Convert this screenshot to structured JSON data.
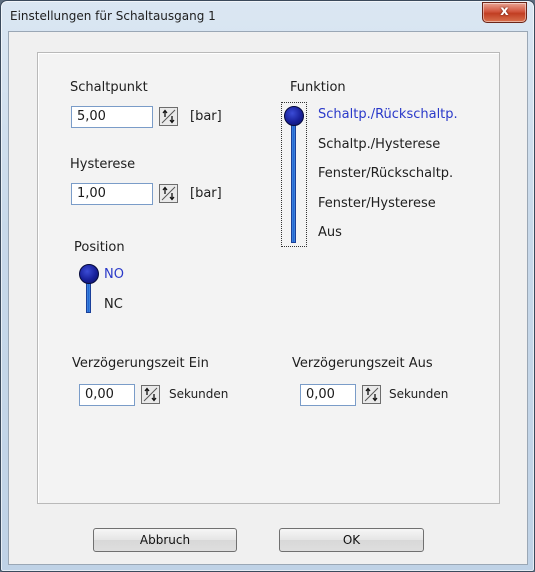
{
  "window": {
    "title": "Einstellungen für Schaltausgang 1",
    "close_label": "x"
  },
  "schaltpunkt": {
    "label": "Schaltpunkt",
    "value": "5,00",
    "unit": "[bar]"
  },
  "hysterese": {
    "label": "Hysterese",
    "value": "1,00",
    "unit": "[bar]"
  },
  "position": {
    "label": "Position",
    "options": [
      "NO",
      "NC"
    ],
    "selected": "NO"
  },
  "funktion": {
    "label": "Funktion",
    "options": [
      "Schaltp./Rückschaltp.",
      "Schaltp./Hysterese",
      "Fenster/Rückschaltp.",
      "Fenster/Hysterese",
      "Aus"
    ],
    "selected": "Schaltp./Rückschaltp."
  },
  "verzoegerung_ein": {
    "label": "Verzögerungszeit Ein",
    "value": "0,00",
    "unit": "Sekunden"
  },
  "verzoegerung_aus": {
    "label": "Verzögerungszeit Aus",
    "value": "0,00",
    "unit": "Sekunden"
  },
  "buttons": {
    "cancel": "Abbruch",
    "ok": "OK"
  },
  "colors": {
    "selector_knob": "#18209a",
    "selector_track": "#1a5fd0",
    "selected_text": "#2a39c9"
  },
  "icons": {
    "spin": "up-down-arrows-icon",
    "close": "close-icon"
  }
}
